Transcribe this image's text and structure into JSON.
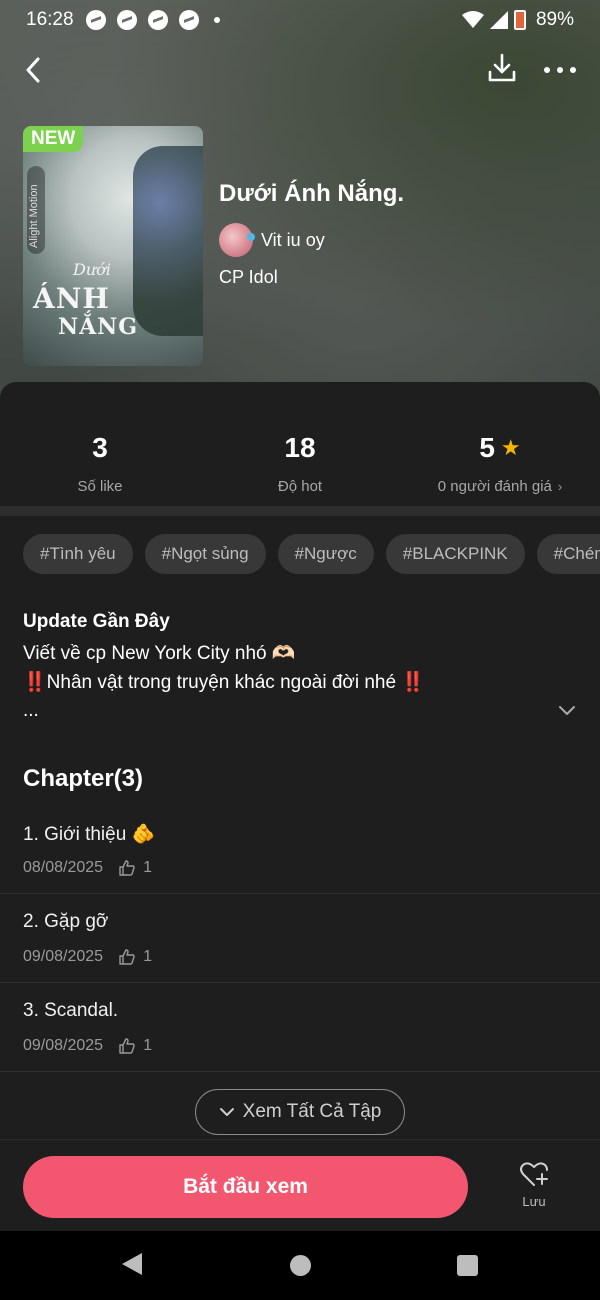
{
  "status_bar": {
    "time": "16:28",
    "battery": "89%"
  },
  "cover": {
    "badge": "NEW",
    "title_line1": "Dưới",
    "title_line2": "ÁNH",
    "title_line3": "NẮNG",
    "watermark": "Alight Motion"
  },
  "story": {
    "title": "Dưới Ánh Nắng.",
    "author": "Vit iu oy",
    "category": "CP Idol"
  },
  "stats": [
    {
      "value": "3",
      "label": "Số like"
    },
    {
      "value": "18",
      "label": "Độ hot"
    },
    {
      "value": "5",
      "label": "0 người đánh giá"
    }
  ],
  "tags": [
    "#Tình yêu",
    "#Ngọt sủng",
    "#Ngược",
    "#BLACKPINK",
    "#Chém"
  ],
  "update": {
    "title": "Update Gần Đây",
    "line1": "Viết về cp New York City nhó 🫶🏻",
    "line2": "‼️Nhân vật trong truyện khác ngoài đời nhé ‼️",
    "line3": "..."
  },
  "chapters": {
    "title": "Chapter(3)",
    "items": [
      {
        "name": "1. Giới thiệu 🫵",
        "date": "08/08/2025",
        "likes": "1"
      },
      {
        "name": "2. Gặp gỡ",
        "date": "09/08/2025",
        "likes": "1"
      },
      {
        "name": "3. Scandal.",
        "date": "09/08/2025",
        "likes": "1"
      }
    ],
    "view_all": "Xem Tất Cả Tập"
  },
  "bottom": {
    "start": "Bắt đầu xem",
    "save": "Lưu"
  },
  "colors": {
    "accent": "#f3566f",
    "new_badge": "#7cd24e",
    "star": "#f4b400",
    "background": "#1e1e1e"
  }
}
